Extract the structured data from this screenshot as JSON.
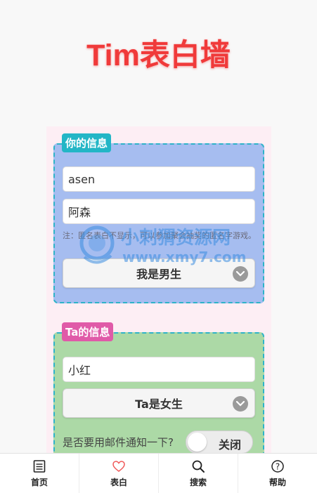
{
  "app": {
    "title": "Tim表白墙"
  },
  "my_info": {
    "legend": "你的信息",
    "name_value": "asen",
    "nickname_value": "阿森",
    "note": "注：匿名表白不显示，可以参加聚会抽奖的匿名字游戏。",
    "gender_select": "我是男生"
  },
  "their_info": {
    "legend": "Ta的信息",
    "name_value": "小红",
    "gender_select": "Ta是女生",
    "notify_label": "是否要用邮件通知一下?",
    "notify_toggle": "关闭"
  },
  "watermark": {
    "name": "小刺猬资源网",
    "url": "www.xmy7.com"
  },
  "tabbar": {
    "items": [
      {
        "label": "首页",
        "icon": "document-icon"
      },
      {
        "label": "表白",
        "icon": "heart-icon"
      },
      {
        "label": "搜索",
        "icon": "search-icon"
      },
      {
        "label": "帮助",
        "icon": "help-icon"
      }
    ]
  },
  "colors": {
    "title": "#f03a3a",
    "panel": "#fdeef4",
    "mine_fieldset": "#a6bdf0",
    "theirs_fieldset": "#acd9a6",
    "mine_legend": "#23b6c6",
    "theirs_legend": "#e05aa8",
    "active_icon": "#f05a5a"
  }
}
